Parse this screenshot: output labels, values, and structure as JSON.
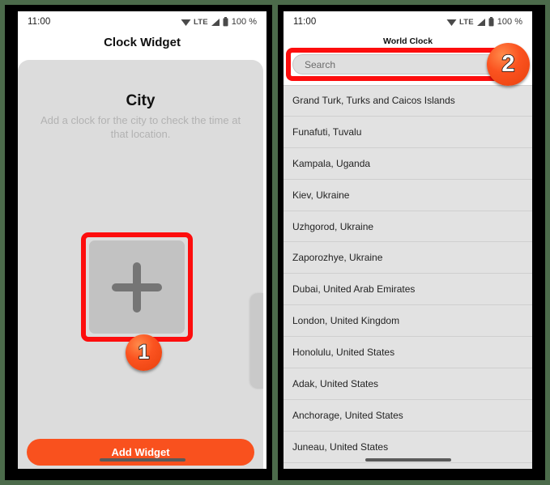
{
  "statusbar": {
    "time": "11:00",
    "network_label": "LTE",
    "battery_percent": "100 %",
    "icons": {
      "wifi": "wifi-icon",
      "signal": "signal-bars-icon",
      "battery": "battery-icon"
    }
  },
  "left_phone": {
    "title": "Clock Widget",
    "card": {
      "heading": "City",
      "description": "Add a clock for the city to check the time at that location."
    },
    "add_tile": {
      "icon": "plus-icon",
      "highlight_color": "#fd0d0d"
    },
    "primary_button": "Add Widget",
    "accent_color": "#f9511e"
  },
  "right_phone": {
    "title": "World Clock",
    "search": {
      "value": "",
      "placeholder": "Search",
      "highlight_color": "#fd0d0d"
    },
    "cities": [
      "Grand Turk, Turks and Caicos Islands",
      "Funafuti, Tuvalu",
      "Kampala, Uganda",
      "Kiev, Ukraine",
      "Uzhgorod, Ukraine",
      "Zaporozhye, Ukraine",
      "Dubai, United Arab Emirates",
      "London, United Kingdom",
      "Honolulu, United States",
      "Adak, United States",
      "Anchorage, United States",
      "Juneau, United States"
    ]
  },
  "annotations": {
    "badge_1": "1",
    "badge_2": "2",
    "badge_color": "#fb5320"
  }
}
